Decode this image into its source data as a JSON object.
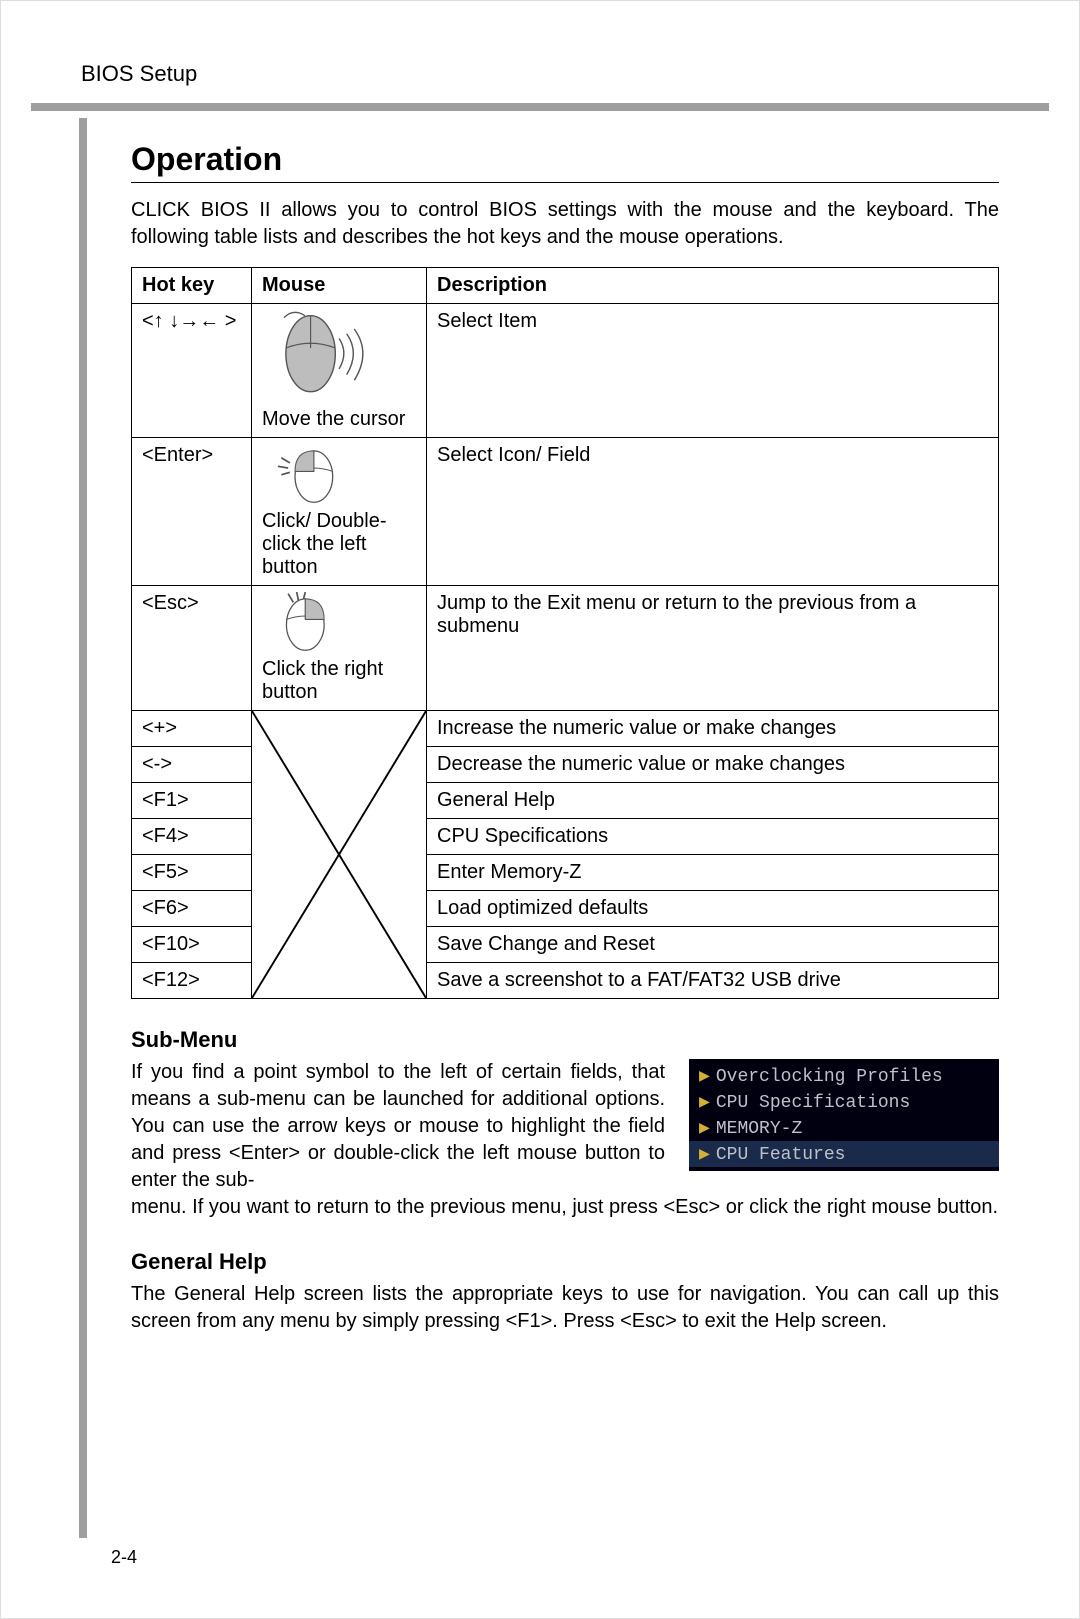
{
  "header_title": "BIOS Setup",
  "section_title": "Operation",
  "intro": "CLICK BIOS II allows you to control BIOS settings with the mouse and the keyboard. The following table lists and describes the hot keys and the mouse operations.",
  "table": {
    "headers": {
      "hotkey": "Hot key",
      "mouse": "Mouse",
      "desc": "Description"
    },
    "r1": {
      "hotkey": "<↑ ↓→← >",
      "mouse": "Move the cursor",
      "desc": "Select Item"
    },
    "r2": {
      "hotkey": "<Enter>",
      "mouse": "Click/ Double-click the left button",
      "desc": "Select  Icon/ Field"
    },
    "r3": {
      "hotkey": "<Esc>",
      "mouse": "Click the right button",
      "desc": "Jump to the Exit menu or return to the previous from a submenu"
    },
    "r4": {
      "hotkey": "<+>",
      "desc": "Increase the numeric value or make changes"
    },
    "r5": {
      "hotkey": "<->",
      "desc": "Decrease the numeric value or make changes"
    },
    "r6": {
      "hotkey": "<F1>",
      "desc": "General Help"
    },
    "r7": {
      "hotkey": "<F4>",
      "desc": "CPU Specifications"
    },
    "r8": {
      "hotkey": "<F5>",
      "desc": "Enter Memory-Z"
    },
    "r9": {
      "hotkey": "<F6>",
      "desc": "Load optimized defaults"
    },
    "r10": {
      "hotkey": "<F10>",
      "desc": "Save Change and Reset"
    },
    "r11": {
      "hotkey": "<F12>",
      "desc": "Save a screenshot to a FAT/FAT32 USB drive"
    }
  },
  "submenu": {
    "title": "Sub-Menu",
    "text_a": "If you find a point symbol to the left of certain fields, that means a sub-menu can be launched for additional options. You can use the arrow keys or mouse to highlight the field and press <Enter> or double-click the left mouse button to enter the sub-",
    "text_b": "menu. If you want to return to the previous menu, just press <Esc> or click the right mouse button.",
    "items": {
      "i0": "Overclocking Profiles",
      "i1": "CPU Specifications",
      "i2": "MEMORY-Z",
      "i3": "CPU Features"
    }
  },
  "generalhelp": {
    "title": "General Help",
    "text": "The General Help screen lists the appropriate keys to use for navigation. You can call up this screen from any menu by simply pressing <F1>. Press <Esc> to exit the Help screen."
  },
  "page_number": "2-4"
}
